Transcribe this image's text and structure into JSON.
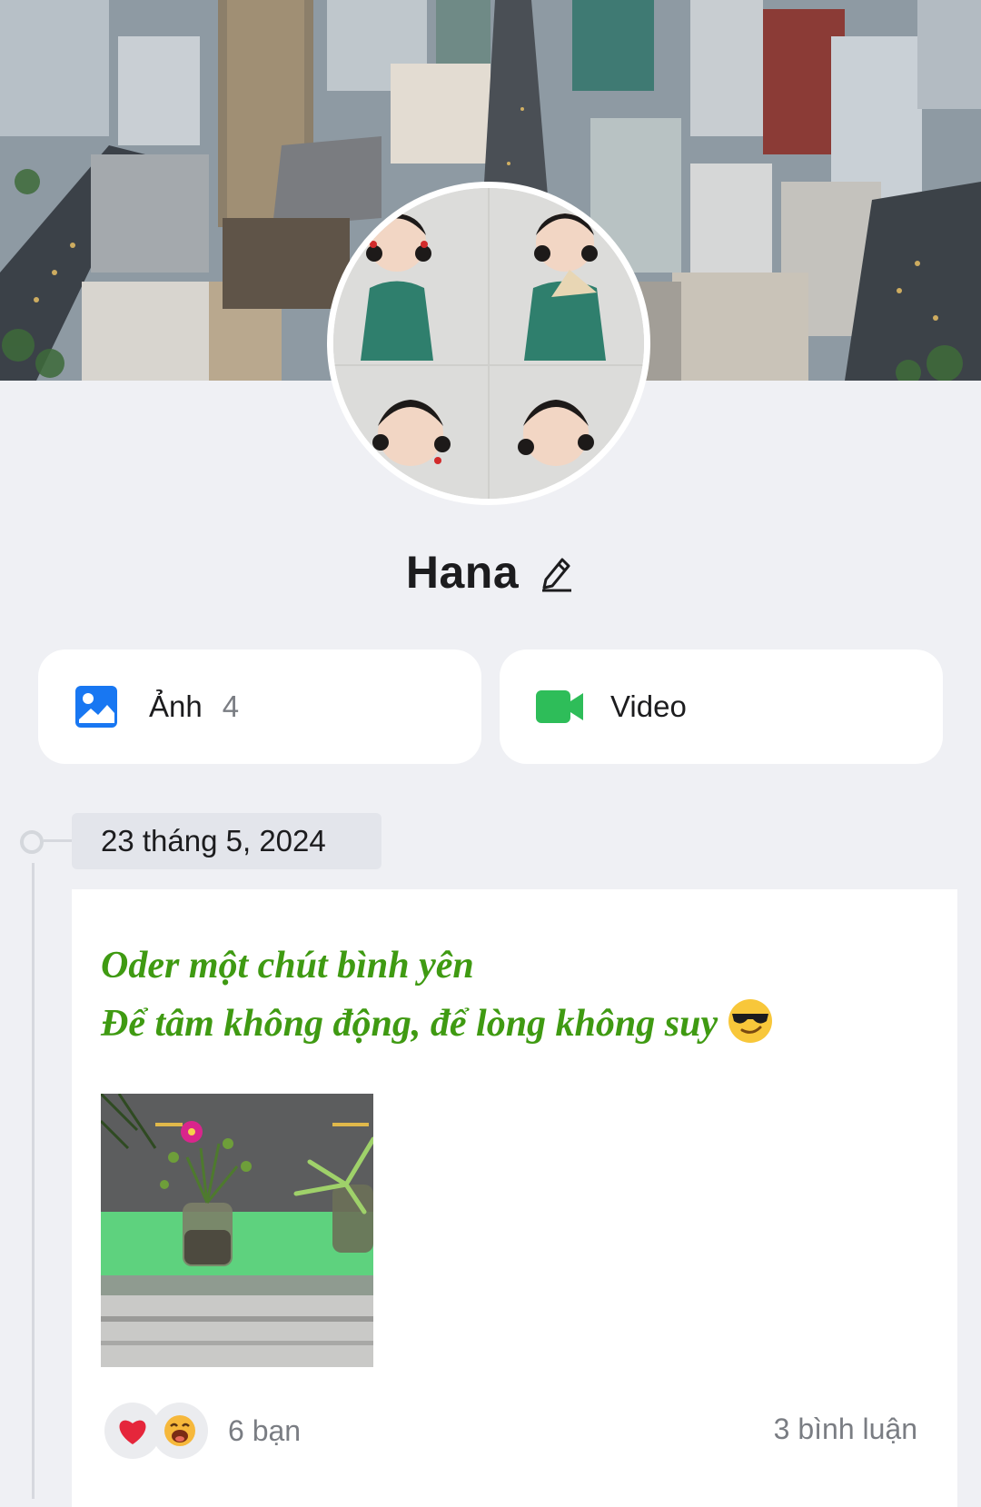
{
  "profile": {
    "name": "Hana",
    "edit_icon": "pencil-icon"
  },
  "media": {
    "photos": {
      "label": "Ảnh",
      "count": "4",
      "icon": "image-icon",
      "color": "#1877f2"
    },
    "videos": {
      "label": "Video",
      "icon": "video-camera-icon",
      "color": "#2ebd59"
    }
  },
  "timeline": {
    "date": "23 tháng 5, 2024"
  },
  "post": {
    "caption_line1": "Oder một chút bình yên",
    "caption_line2": "Để tâm không động, để lòng không suy",
    "caption_emoji": "smiling-face-with-sunglasses",
    "caption_color": "#3f9a12",
    "reactions": [
      "heart",
      "laughing-face"
    ],
    "likes": "6 bạn",
    "comments": "3 bình luận"
  }
}
